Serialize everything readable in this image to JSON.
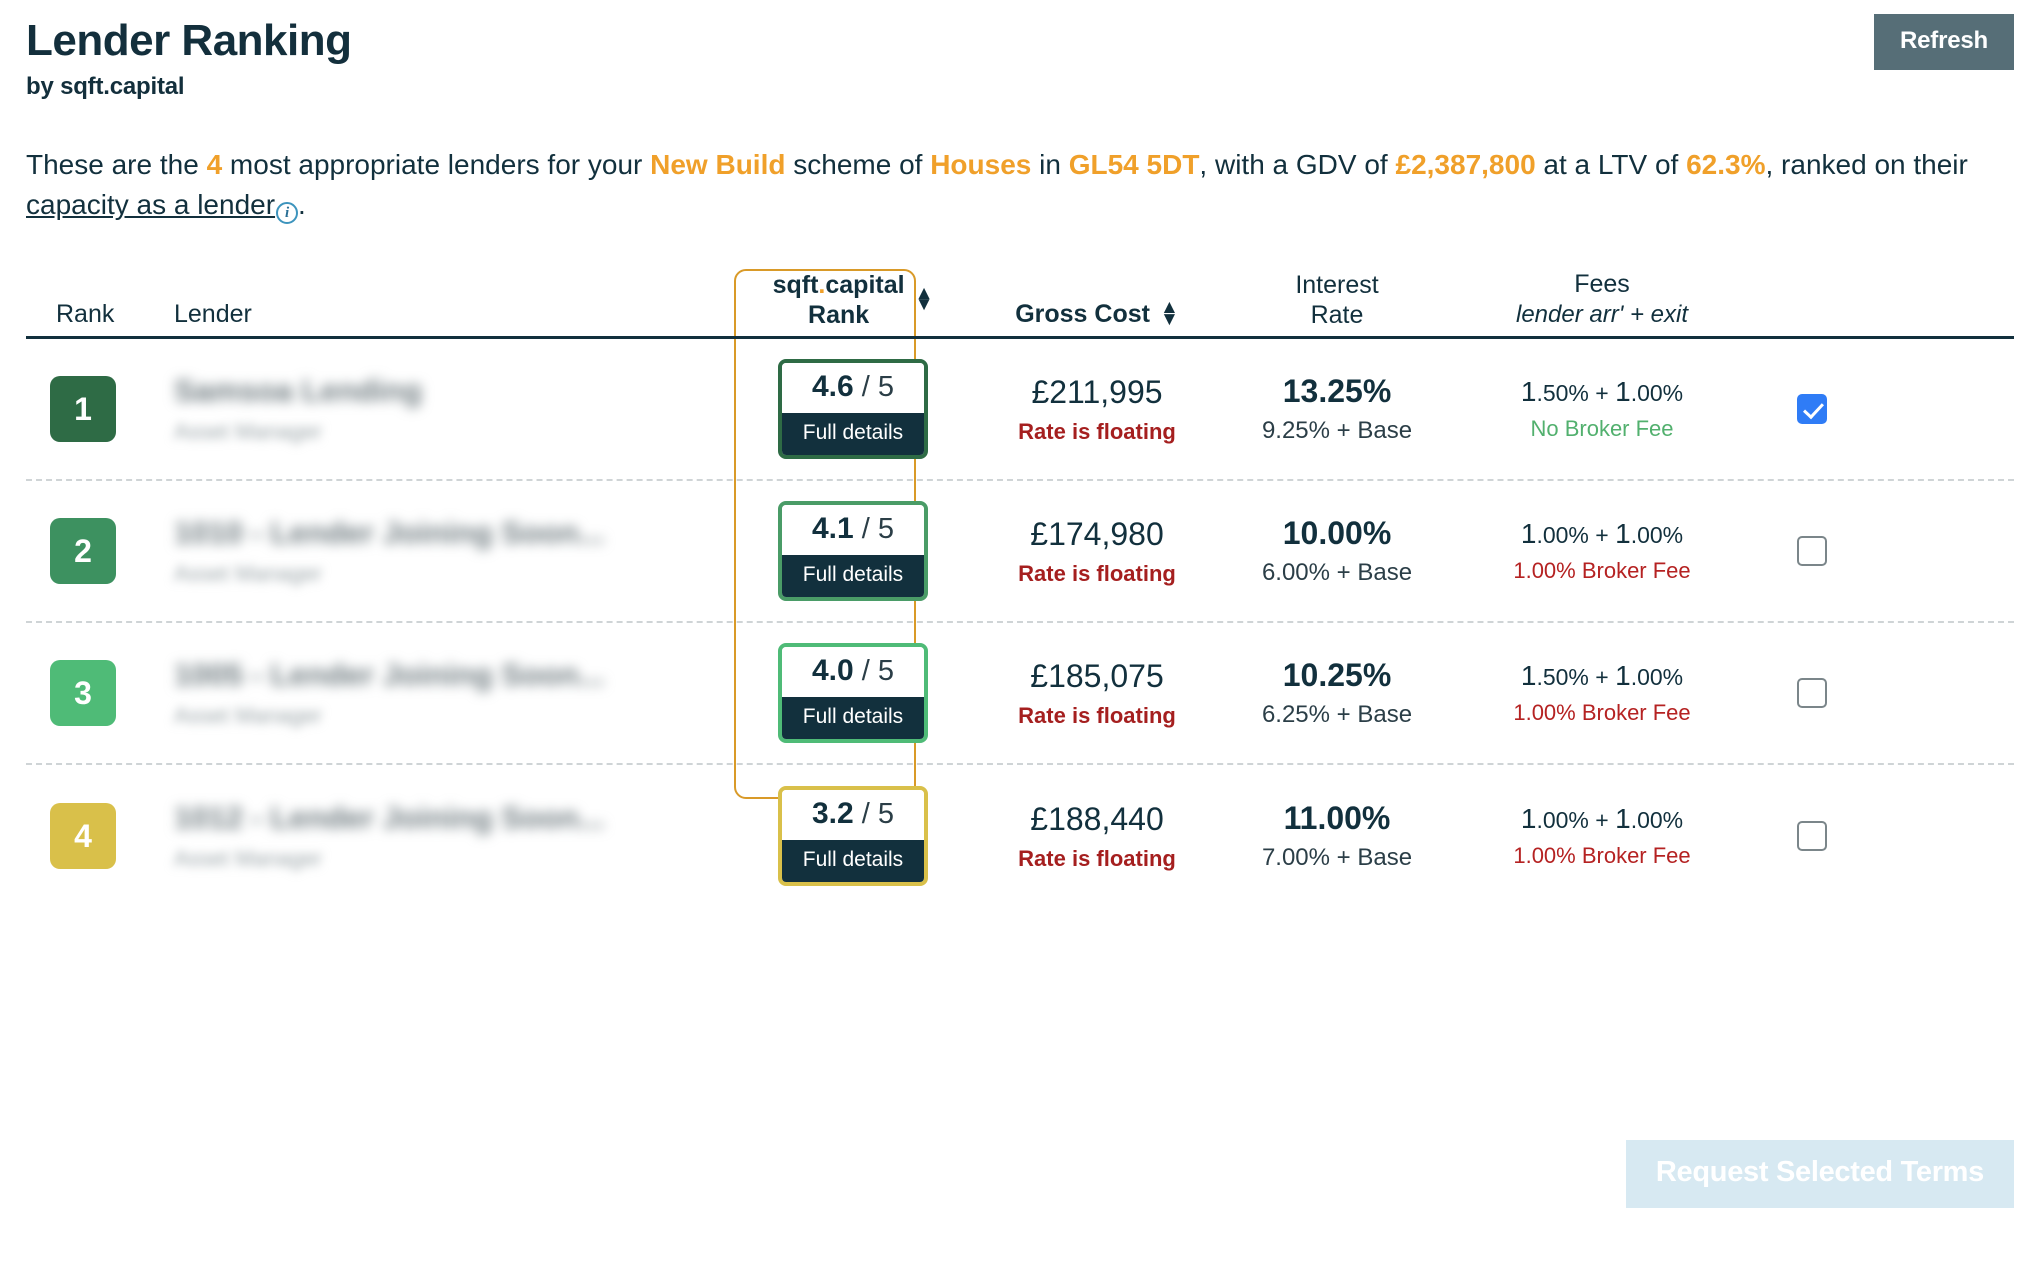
{
  "header": {
    "title": "Lender Ranking",
    "subtitle": "by sqft.capital",
    "refresh_label": "Refresh"
  },
  "intro": {
    "t1": "These are the ",
    "count": "4",
    "t2": " most appropriate lenders for your ",
    "scheme_type": "New Build",
    "t3": " scheme of ",
    "property_type": "Houses",
    "t4": " in ",
    "postcode": "GL54 5DT",
    "t5": ", with a GDV of ",
    "gdv": "£2,387,800",
    "t6": " at a LTV of ",
    "ltv": "62.3%",
    "t7": ", ranked on their ",
    "link": "capacity as a lender",
    "info_glyph": "i",
    "t8": "."
  },
  "table": {
    "headers": {
      "rank": "Rank",
      "lender": "Lender",
      "score_line1": "sqft",
      "score_dot": ".",
      "score_line1b": "capital",
      "score_line2": "Rank",
      "gross_cost": "Gross Cost",
      "interest_rate_line1": "Interest",
      "interest_rate_line2": "Rate",
      "fees": "Fees",
      "fees_sub": "lender arr' + exit",
      "sort_up": "▲",
      "sort_down": "▼"
    },
    "rows": [
      {
        "rank": "1",
        "rank_color": "#2e6b45",
        "lender_name": "Samsoa Lending",
        "lender_sub": "Asset Manager",
        "score": "4.6",
        "score_max": "/ 5",
        "details_label": "Full details",
        "gross_cost": "£211,995",
        "gross_note": "Rate is floating",
        "rate": "13.25%",
        "rate_note": "9.25% + Base",
        "fee_a_int": "1",
        "fee_a_dec": ".50%",
        "fee_plus": " + ",
        "fee_b_int": "1",
        "fee_b_dec": ".00%",
        "fee_note": "No Broker Fee",
        "fee_note_type": "green",
        "checked": true
      },
      {
        "rank": "2",
        "rank_color": "#3d9160",
        "lender_name": "1010 - Lender Joining Soon...",
        "lender_sub": "Asset Manager",
        "score": "4.1",
        "score_max": "/ 5",
        "details_label": "Full details",
        "gross_cost": "£174,980",
        "gross_note": "Rate is floating",
        "rate": "10.00%",
        "rate_note": "6.00% + Base",
        "fee_a_int": "1",
        "fee_a_dec": ".00%",
        "fee_plus": " + ",
        "fee_b_int": "1",
        "fee_b_dec": ".00%",
        "fee_note": "1.00% Broker Fee",
        "fee_note_type": "red",
        "checked": false
      },
      {
        "rank": "3",
        "rank_color": "#4fbb77",
        "lender_name": "1005 - Lender Joining Soon...",
        "lender_sub": "Asset Manager",
        "score": "4.0",
        "score_max": "/ 5",
        "details_label": "Full details",
        "gross_cost": "£185,075",
        "gross_note": "Rate is floating",
        "rate": "10.25%",
        "rate_note": "6.25% + Base",
        "fee_a_int": "1",
        "fee_a_dec": ".50%",
        "fee_plus": " + ",
        "fee_b_int": "1",
        "fee_b_dec": ".00%",
        "fee_note": "1.00% Broker Fee",
        "fee_note_type": "red",
        "checked": false
      },
      {
        "rank": "4",
        "rank_color": "#d9c04a",
        "lender_name": "1012 - Lender Joining Soon...",
        "lender_sub": "Asset Manager",
        "score": "3.2",
        "score_max": "/ 5",
        "details_label": "Full details",
        "gross_cost": "£188,440",
        "gross_note": "Rate is floating",
        "rate": "11.00%",
        "rate_note": "7.00% + Base",
        "fee_a_int": "1",
        "fee_a_dec": ".00%",
        "fee_plus": " + ",
        "fee_b_int": "1",
        "fee_b_dec": ".00%",
        "fee_note": "1.00% Broker Fee",
        "fee_note_type": "red",
        "checked": false
      }
    ]
  },
  "footer": {
    "request_label": "Request Selected Terms"
  },
  "colors": {
    "accent_orange": "#f0a02a",
    "navy": "#12303d",
    "checkbox_blue": "#2f7cf6",
    "red": "#a51f1f",
    "green": "#52b06e"
  }
}
